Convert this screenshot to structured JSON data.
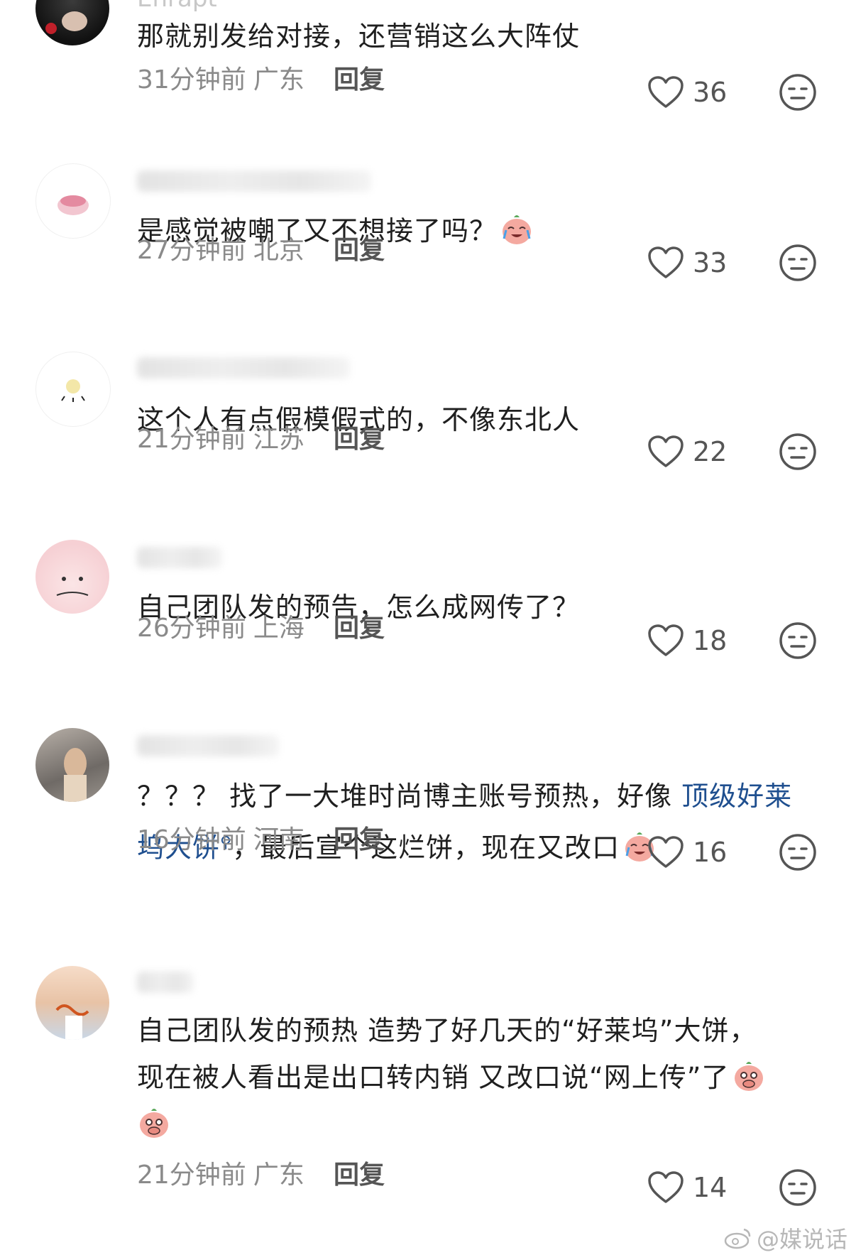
{
  "comments": [
    {
      "username_partial": "Enrapt",
      "text_lines": [
        "那就别发给对接，还营销这么大阵仗"
      ],
      "time": "31分钟前",
      "location": "广东",
      "reply_label": "回复",
      "likes": "36"
    },
    {
      "text_lines": [
        "是感觉被嘲了又不想接了吗？"
      ],
      "emoji": "crying-laugh-emoji",
      "time": "27分钟前",
      "location": "北京",
      "reply_label": "回复",
      "likes": "33"
    },
    {
      "text_lines": [
        "这个人有点假模假式的，不像东北人"
      ],
      "time": "21分钟前",
      "location": "江苏",
      "reply_label": "回复",
      "likes": "22"
    },
    {
      "text_lines": [
        "自己团队发的预告，怎么成网传了？"
      ],
      "time": "26分钟前",
      "location": "上海",
      "reply_label": "回复",
      "likes": "18"
    },
    {
      "line1_prefix": "？？？ 找了一大堆时尚博主账号预热，好像 ",
      "line1_link": "顶级好莱",
      "line2_link": "坞大饼",
      "line2_suffix": "，最后宣个这烂饼，现在又改口",
      "emoji": "crying-laugh-emoji",
      "time": "16分钟前",
      "location": "河南",
      "reply_label": "回复",
      "likes": "16"
    },
    {
      "text_lines": [
        "自己团队发的预热 造势了好几天的“好莱坞”大饼，",
        "现在被人看出是出口转内销 又改口说“网上传”了"
      ],
      "emoji": "covering-mouth-emoji",
      "time": "21分钟前",
      "location": "广东",
      "reply_label": "回复",
      "likes": "14"
    }
  ],
  "watermark": "@媒说话",
  "colors": {
    "text": "#1f1f1f",
    "meta": "#8a8a8a",
    "link": "#1f4f8f",
    "icon": "#555555"
  }
}
